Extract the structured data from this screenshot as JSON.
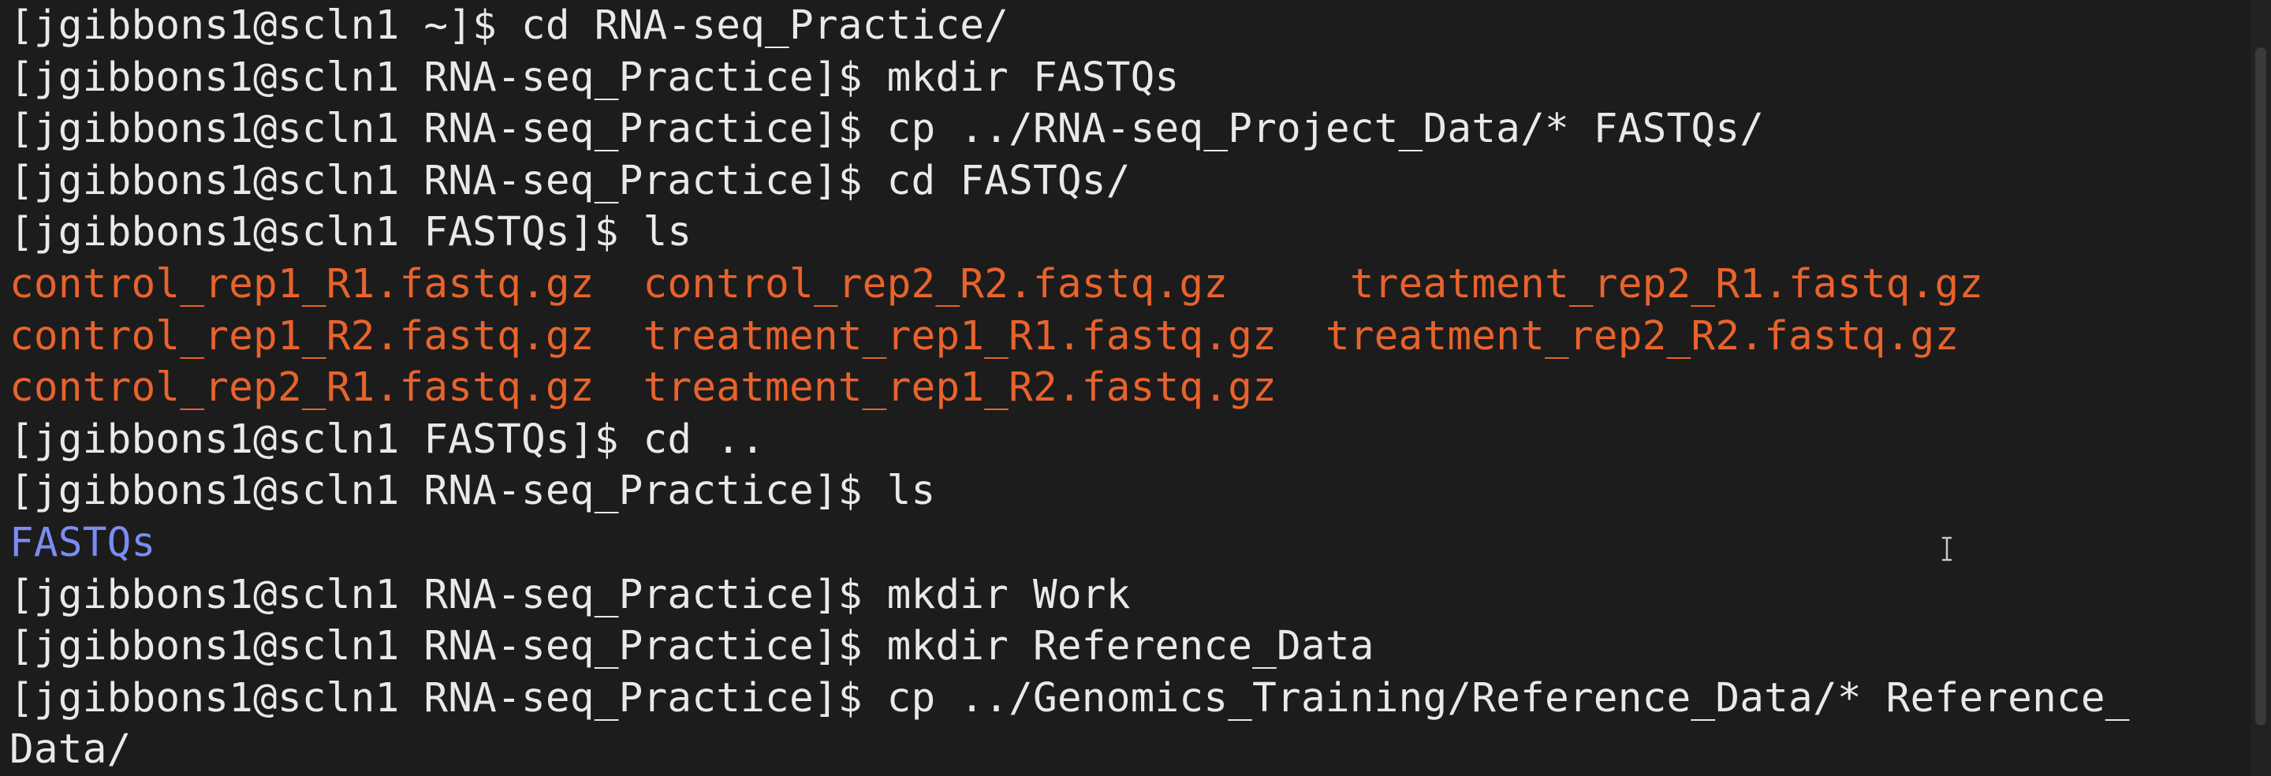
{
  "terminal": {
    "lines": [
      [
        {
          "t": "[jgibbons1@scln1 ~]$ cd RNA-seq_Practice/",
          "c": "default"
        }
      ],
      [
        {
          "t": "[jgibbons1@scln1 RNA-seq_Practice]$ mkdir FASTQs",
          "c": "default"
        }
      ],
      [
        {
          "t": "[jgibbons1@scln1 RNA-seq_Practice]$ cp ../RNA-seq_Project_Data/* FASTQs/",
          "c": "default"
        }
      ],
      [
        {
          "t": "[jgibbons1@scln1 RNA-seq_Practice]$ cd FASTQs/",
          "c": "default"
        }
      ],
      [
        {
          "t": "[jgibbons1@scln1 FASTQs]$ ls",
          "c": "default"
        }
      ],
      [
        {
          "t": "control_rep1_R1.fastq.gz  control_rep2_R2.fastq.gz     treatment_rep2_R1.fastq.gz",
          "c": "orange"
        }
      ],
      [
        {
          "t": "control_rep1_R2.fastq.gz  treatment_rep1_R1.fastq.gz  treatment_rep2_R2.fastq.gz",
          "c": "orange"
        }
      ],
      [
        {
          "t": "control_rep2_R1.fastq.gz  treatment_rep1_R2.fastq.gz",
          "c": "orange"
        }
      ],
      [
        {
          "t": "[jgibbons1@scln1 FASTQs]$ cd ..",
          "c": "default"
        }
      ],
      [
        {
          "t": "[jgibbons1@scln1 RNA-seq_Practice]$ ls",
          "c": "default"
        }
      ],
      [
        {
          "t": "FASTQs",
          "c": "blue"
        }
      ],
      [
        {
          "t": "[jgibbons1@scln1 RNA-seq_Practice]$ mkdir Work",
          "c": "default"
        }
      ],
      [
        {
          "t": "[jgibbons1@scln1 RNA-seq_Practice]$ mkdir Reference_Data",
          "c": "default"
        }
      ],
      [
        {
          "t": "[jgibbons1@scln1 RNA-seq_Practice]$ cp ../Genomics_Training/Reference_Data/* Reference_",
          "c": "default"
        }
      ],
      [
        {
          "t": "Data/",
          "c": "default"
        }
      ]
    ]
  },
  "colors": {
    "background": "#1c1c1c",
    "text": "#e9e9e9",
    "fastq_file": "#e8632c",
    "directory": "#7b8cf2"
  },
  "icons": {
    "cursor": "text-cursor-icon"
  }
}
